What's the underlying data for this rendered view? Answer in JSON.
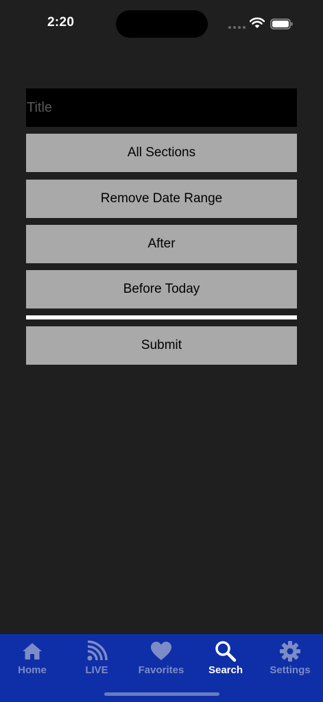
{
  "status_bar": {
    "time": "2:20"
  },
  "search_form": {
    "title_placeholder": "Title",
    "title_value": "",
    "sections_button": "All Sections",
    "date_range_button": "Remove Date Range",
    "after_button": "After",
    "before_button": "Before Today",
    "submit_button": "Submit"
  },
  "tab_bar": {
    "items": [
      {
        "label": "Home",
        "icon": "home-icon",
        "active": false
      },
      {
        "label": "LIVE",
        "icon": "rss-icon",
        "active": false
      },
      {
        "label": "Favorites",
        "icon": "heart-icon",
        "active": false
      },
      {
        "label": "Search",
        "icon": "search-icon",
        "active": true
      },
      {
        "label": "Settings",
        "icon": "gear-icon",
        "active": false
      }
    ]
  },
  "colors": {
    "background": "#1f1f1f",
    "button": "#a9a9a9",
    "tab_bar": "#0f2fa8",
    "tab_inactive": "#7c8cc6",
    "tab_active": "#ffffff"
  }
}
